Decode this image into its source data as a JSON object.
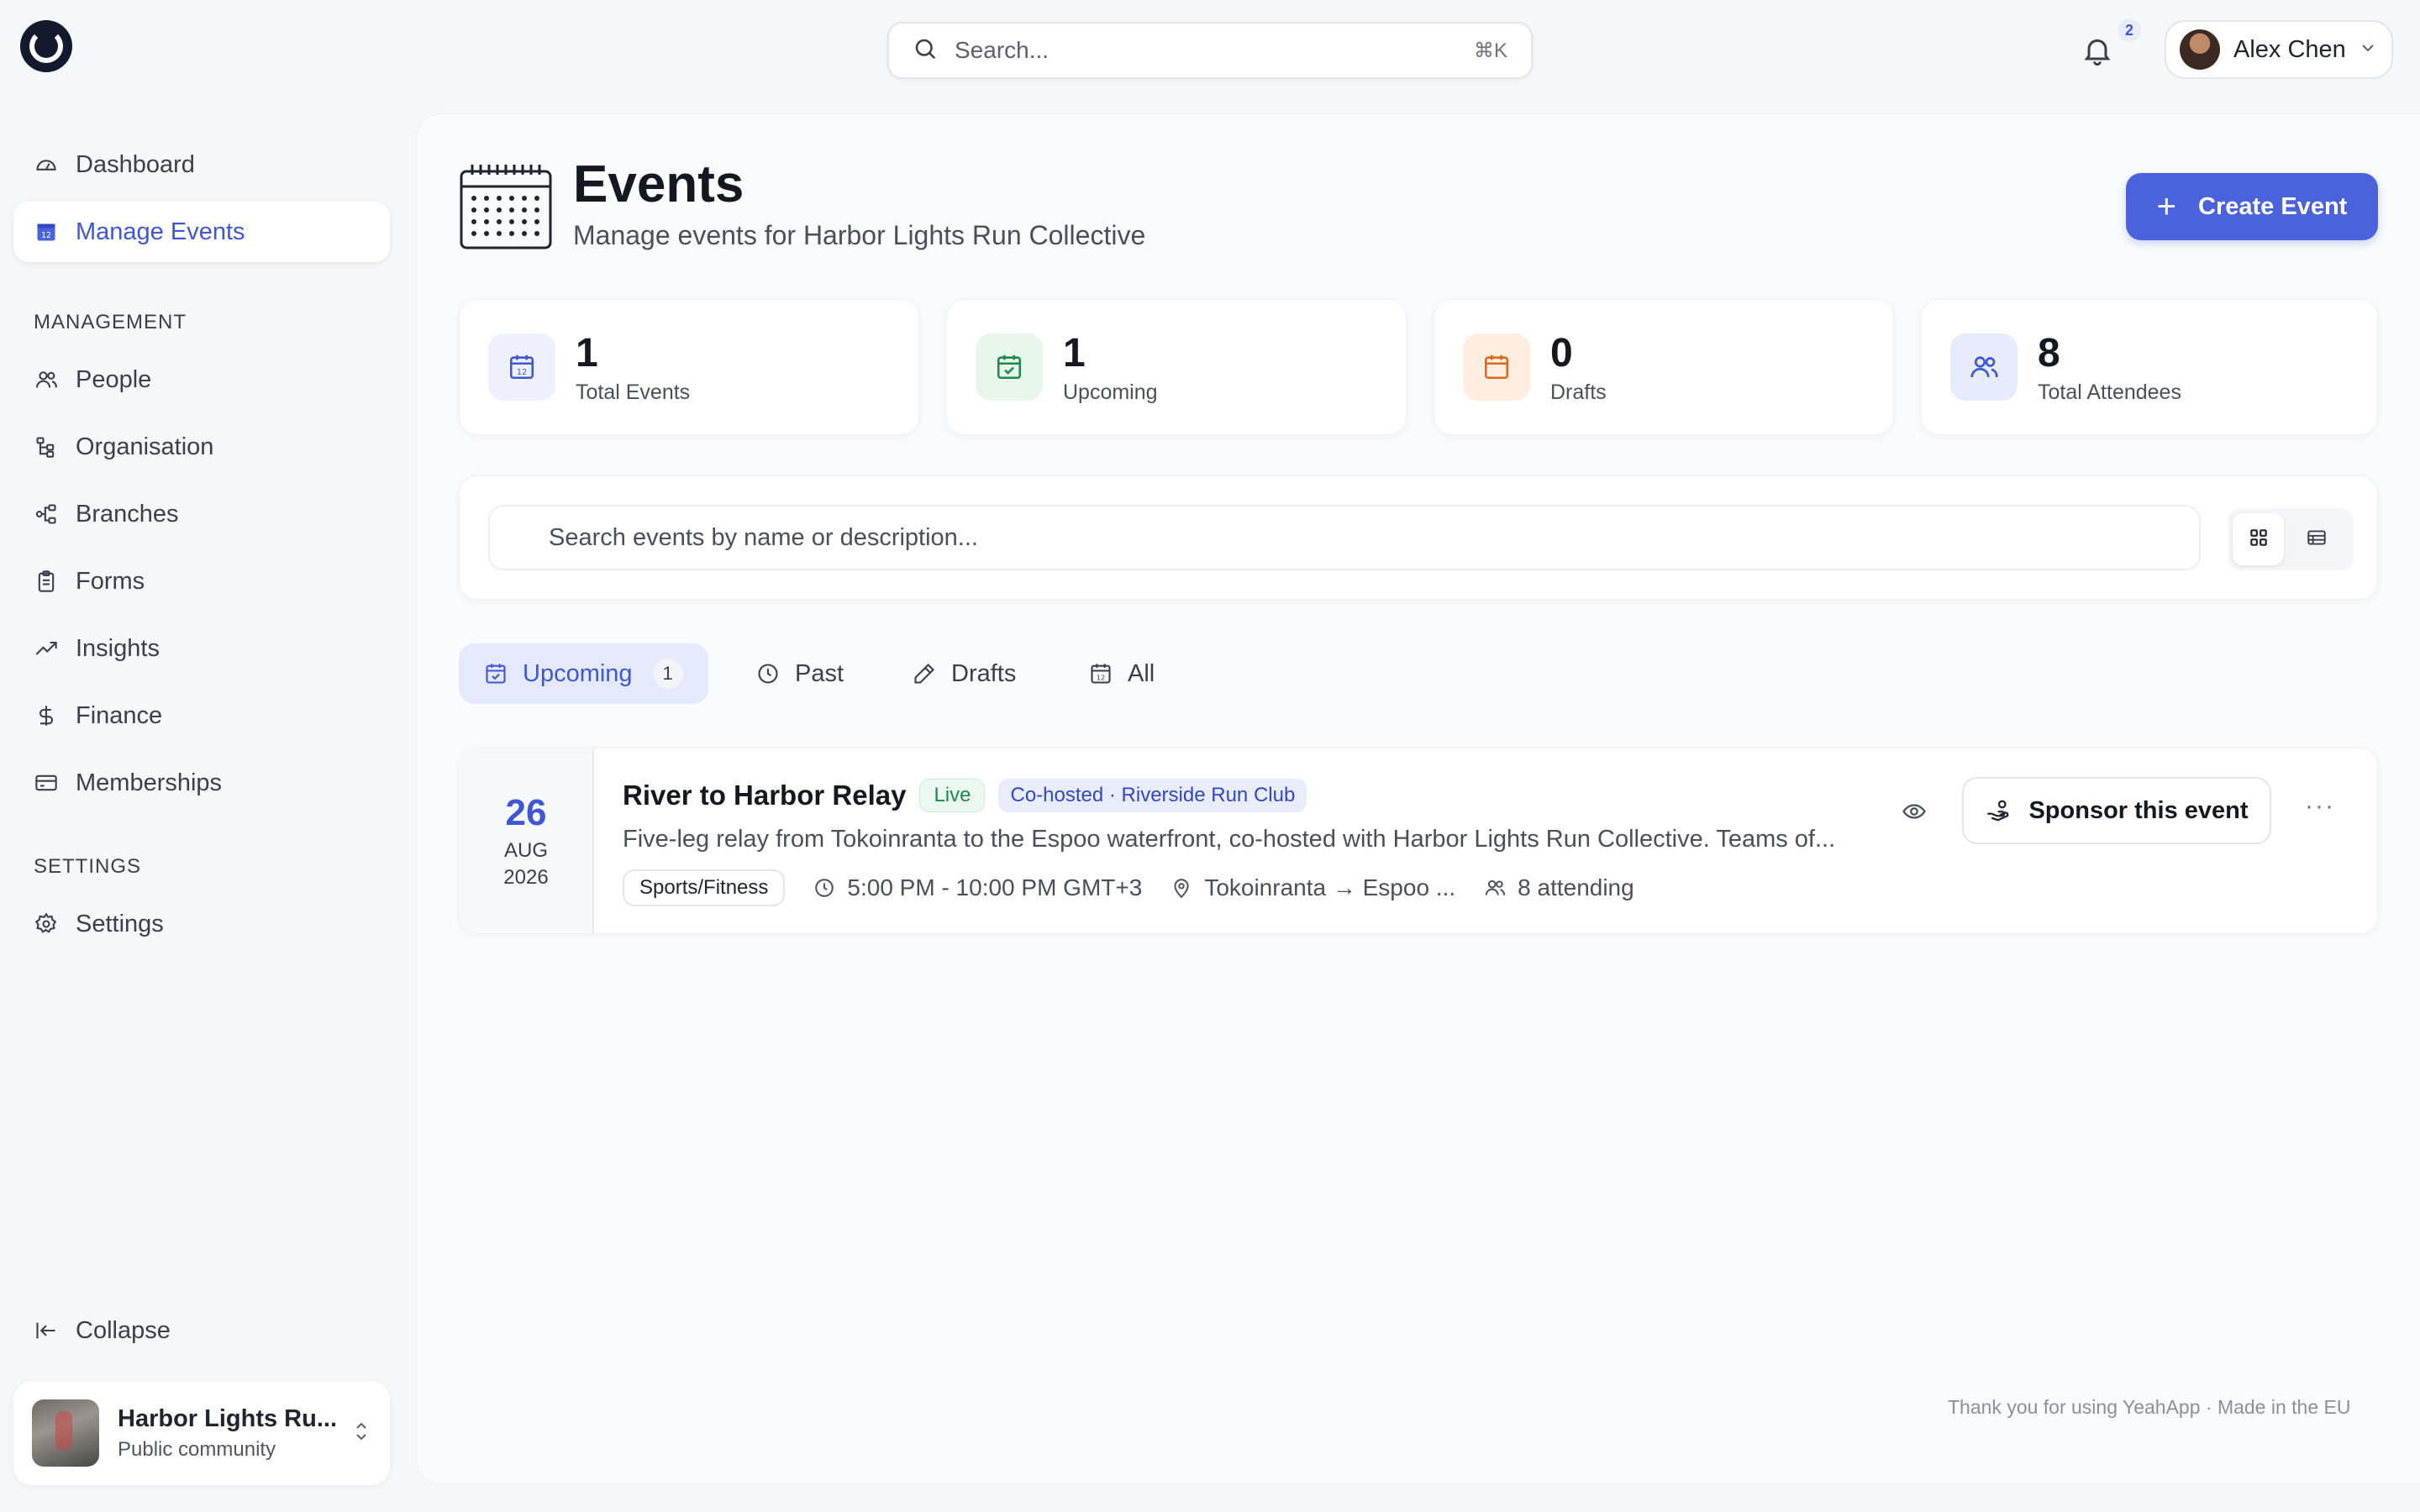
{
  "topbar": {
    "search_placeholder": "Search...",
    "search_shortcut": "⌘K",
    "notification_count": "2",
    "user_name": "Alex Chen"
  },
  "sidebar": {
    "primary": [
      {
        "label": "Dashboard",
        "icon": "dashboard-icon"
      },
      {
        "label": "Manage Events",
        "icon": "calendar-icon",
        "active": true
      }
    ],
    "management_heading": "MANAGEMENT",
    "management": [
      {
        "label": "People",
        "icon": "people-icon"
      },
      {
        "label": "Organisation",
        "icon": "org-tree-icon"
      },
      {
        "label": "Branches",
        "icon": "branches-icon"
      },
      {
        "label": "Forms",
        "icon": "clipboard-icon"
      },
      {
        "label": "Insights",
        "icon": "trend-icon"
      },
      {
        "label": "Finance",
        "icon": "dollar-icon"
      },
      {
        "label": "Memberships",
        "icon": "card-icon"
      }
    ],
    "settings_heading": "SETTINGS",
    "settings": [
      {
        "label": "Settings",
        "icon": "gear-icon"
      }
    ],
    "collapse_label": "Collapse",
    "org": {
      "name": "Harbor Lights Ru...",
      "type": "Public community"
    }
  },
  "header": {
    "title": "Events",
    "subtitle": "Manage events for Harbor Lights Run Collective",
    "create_label": "Create Event"
  },
  "stats": [
    {
      "value": "1",
      "label": "Total Events",
      "icon": "calendar-icon",
      "color": "#4057d4",
      "bg": "#eef1fb"
    },
    {
      "value": "1",
      "label": "Upcoming",
      "icon": "calendar-check-icon",
      "color": "#1d8a4b",
      "bg": "#e7f7ec"
    },
    {
      "value": "0",
      "label": "Drafts",
      "icon": "calendar-icon",
      "color": "#e0671e",
      "bg": "#fdeedf"
    },
    {
      "value": "8",
      "label": "Total Attendees",
      "icon": "people-icon",
      "color": "#4057d4",
      "bg": "#e6ecfb"
    }
  ],
  "filter": {
    "search_placeholder": "Search events by name or description..."
  },
  "tabs": [
    {
      "label": "Upcoming",
      "count": "1",
      "active": true
    },
    {
      "label": "Past"
    },
    {
      "label": "Drafts"
    },
    {
      "label": "All"
    }
  ],
  "event": {
    "day": "26",
    "month": "AUG",
    "year": "2026",
    "title": "River to Harbor Relay",
    "status": "Live",
    "cohost": "Co-hosted · Riverside Run Club",
    "description": "Five-leg relay from Tokoinranta to the Espoo waterfront, co-hosted with Harbor Lights Run Collective. Teams of...",
    "category": "Sports/Fitness",
    "time": "5:00 PM - 10:00 PM GMT+3",
    "location": "Tokoinranta → Espoo ...",
    "attending": "8 attending",
    "sponsor_label": "Sponsor this event"
  },
  "footer": "Thank you for using YeahApp · Made in the EU"
}
